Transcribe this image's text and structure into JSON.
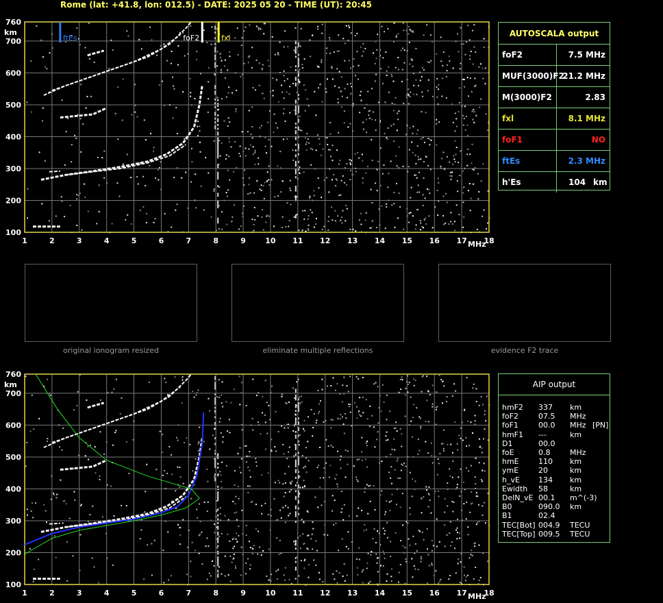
{
  "header": "Rome (lat: +41.8, lon: 012.5) - DATE: 2025 05 20 - TIME (UT): 20:45",
  "ionogram": {
    "y_unit": "km",
    "x_unit": "MHz",
    "y_ticks": [
      "760",
      "700",
      "600",
      "500",
      "400",
      "300",
      "200",
      "100"
    ],
    "x_ticks": [
      "1",
      "2",
      "3",
      "4",
      "5",
      "6",
      "7",
      "8",
      "9",
      "10",
      "11",
      "12",
      "13",
      "14",
      "15",
      "16",
      "17",
      "18"
    ],
    "markers": {
      "ftEs": {
        "label": "ftEs",
        "freq_mhz": 2.3,
        "color": "#2f7cf0"
      },
      "foF2": {
        "label": "foF2",
        "freq_mhz": 7.5,
        "color": "#ffffff"
      },
      "fxI": {
        "label": "fxl",
        "freq_mhz": 8.1,
        "color": "#ffff33"
      }
    }
  },
  "autoscala": {
    "title": "AUTOSCALA output",
    "rows": [
      {
        "param": "foF2",
        "value": "7.5 MHz",
        "color": "#ffffff"
      },
      {
        "param": "MUF(3000)F2",
        "value": "21.2 MHz",
        "color": "#ffffff"
      },
      {
        "param": "M(3000)F2",
        "value": "2.83",
        "color": "#ffffff"
      },
      {
        "param": "fxl",
        "value": "8.1 MHz",
        "color": "#e6e633"
      },
      {
        "param": "foF1",
        "value": "NO",
        "color": "#ff2222"
      },
      {
        "param": "ftEs",
        "value": "2.3 MHz",
        "color": "#2f8cff"
      },
      {
        "param": "h'Es",
        "value": "104",
        "unit": "km",
        "color": "#ffffff"
      }
    ]
  },
  "thumbnails": [
    {
      "caption": "original ionogram resized"
    },
    {
      "caption": "eliminate multiple reflections"
    },
    {
      "caption": "evidence F2 trace"
    }
  ],
  "aip": {
    "title": "AIP output",
    "rows": [
      {
        "name": "hmF2",
        "value": "337",
        "unit": "km",
        "extra": ""
      },
      {
        "name": "foF2",
        "value": "07.5",
        "unit": "MHz",
        "extra": ""
      },
      {
        "name": "foF1",
        "value": "00.0",
        "unit": "MHz",
        "extra": "[PN]"
      },
      {
        "name": "hmF1",
        "value": "---",
        "unit": "km",
        "extra": ""
      },
      {
        "name": "D1",
        "value": "00.0",
        "unit": "",
        "extra": ""
      },
      {
        "name": "foE",
        "value": "0.8",
        "unit": "MHz",
        "extra": ""
      },
      {
        "name": "hmE",
        "value": "110",
        "unit": "km",
        "extra": ""
      },
      {
        "name": "ymE",
        "value": "20",
        "unit": "km",
        "extra": ""
      },
      {
        "name": "h_vE",
        "value": "134",
        "unit": "km",
        "extra": ""
      },
      {
        "name": "Ewidth",
        "value": "58",
        "unit": "km",
        "extra": ""
      },
      {
        "name": "DelN_vE",
        "value": "00.1",
        "unit": "m^(-3)",
        "extra": ""
      },
      {
        "name": "B0",
        "value": "090.0",
        "unit": "km",
        "extra": ""
      },
      {
        "name": "B1",
        "value": "02.4",
        "unit": "",
        "extra": ""
      },
      {
        "name": "TEC[Bot]",
        "value": "004.9",
        "unit": "TECU",
        "extra": ""
      },
      {
        "name": "TEC[Top]",
        "value": "009.5",
        "unit": "TECU",
        "extra": ""
      }
    ]
  },
  "colors": {
    "frame": "#e6d84a",
    "grid": "#7a7a7a",
    "table_border": "#7dcf7d",
    "profile_blue": "#2233ff",
    "model_green": "#22dd22"
  }
}
